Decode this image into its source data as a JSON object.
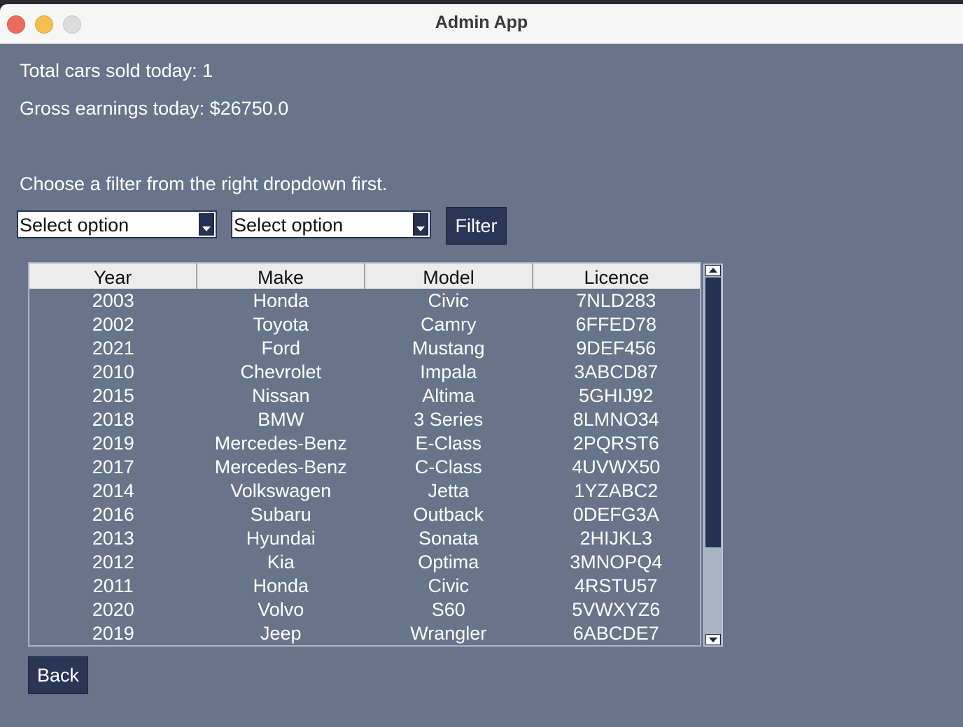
{
  "window": {
    "title": "Admin App"
  },
  "stats": {
    "cars_sold": "Total cars sold today: 1",
    "gross_earnings": "Gross earnings today: $26750.0"
  },
  "instruction": "Choose a filter from the right dropdown first.",
  "filters": {
    "left_select": "Select option",
    "right_select": "Select option",
    "filter_button": "Filter"
  },
  "table": {
    "columns": [
      "Year",
      "Make",
      "Model",
      "Licence"
    ],
    "rows": [
      [
        "2003",
        "Honda",
        "Civic",
        "7NLD283"
      ],
      [
        "2002",
        "Toyota",
        "Camry",
        "6FFED78"
      ],
      [
        "2021",
        "Ford",
        "Mustang",
        "9DEF456"
      ],
      [
        "2010",
        "Chevrolet",
        "Impala",
        "3ABCD87"
      ],
      [
        "2015",
        "Nissan",
        "Altima",
        "5GHIJ92"
      ],
      [
        "2018",
        "BMW",
        "3 Series",
        "8LMNO34"
      ],
      [
        "2019",
        "Mercedes-Benz",
        "E-Class",
        "2PQRST6"
      ],
      [
        "2017",
        "Mercedes-Benz",
        "C-Class",
        "4UVWX50"
      ],
      [
        "2014",
        "Volkswagen",
        "Jetta",
        "1YZABC2"
      ],
      [
        "2016",
        "Subaru",
        "Outback",
        "0DEFG3A"
      ],
      [
        "2013",
        "Hyundai",
        "Sonata",
        "2HIJKL3"
      ],
      [
        "2012",
        "Kia",
        "Optima",
        "3MNOPQ4"
      ],
      [
        "2011",
        "Honda",
        "Civic",
        "4RSTU57"
      ],
      [
        "2020",
        "Volvo",
        "S60",
        "5VWXYZ6"
      ],
      [
        "2019",
        "Jeep",
        "Wrangler",
        "6ABCDE7"
      ]
    ]
  },
  "back_button": "Back",
  "colors": {
    "background": "#67748a",
    "button": "#2a3656",
    "titlebar": "#f6f6f6"
  }
}
